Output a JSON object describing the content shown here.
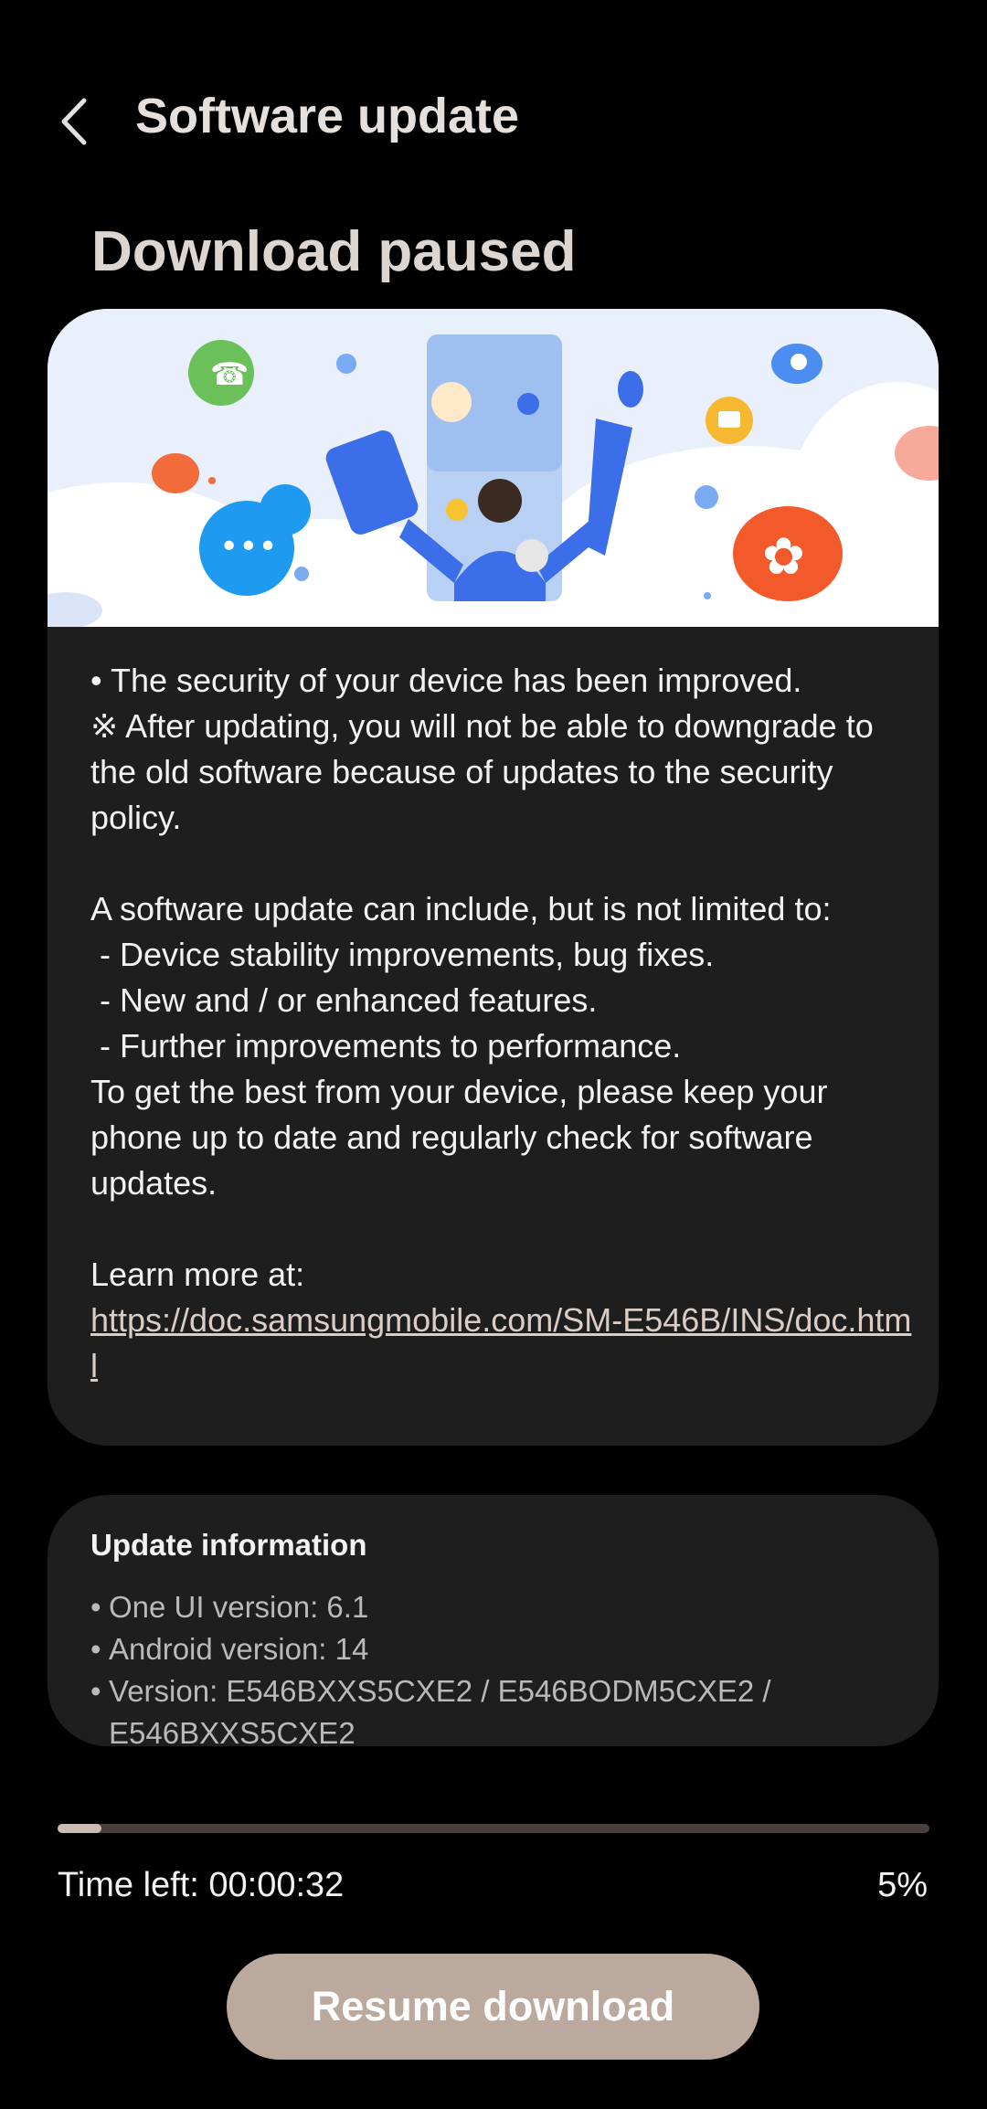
{
  "header": {
    "title": "Software update"
  },
  "status_title": "Download paused",
  "notes": {
    "line1": "• The security of your device has been improved.",
    "line2": "※ After updating, you will not be able to downgrade to the old software because of updates to the security policy.",
    "intro": "A software update can include, but is not limited to:",
    "items": [
      " - Device stability improvements, bug fixes.",
      " - New and / or enhanced features.",
      " - Further improvements to performance."
    ],
    "closing": "To get the best from your device, please keep your phone up to date and regularly check for software updates.",
    "learn_more": "Learn more at:",
    "link": "https://doc.samsungmobile.com/SM-E546B/INS/doc.html"
  },
  "update_info": {
    "title": "Update information",
    "items": [
      "One UI version: 6.1",
      "Android version: 14",
      "Version: E546BXXS5CXE2 / E546BODM5CXE2 / E546BXXS5CXE2"
    ]
  },
  "progress": {
    "percent_label": "5%",
    "fraction": 0.05,
    "time_left": "Time left: 00:00:32"
  },
  "resume_button": "Resume download",
  "colors": {
    "accent": "#bba99d",
    "card_bg": "#1e1e1e",
    "progress_track": "#4a403b",
    "progress_fill": "#c9bcb4"
  }
}
